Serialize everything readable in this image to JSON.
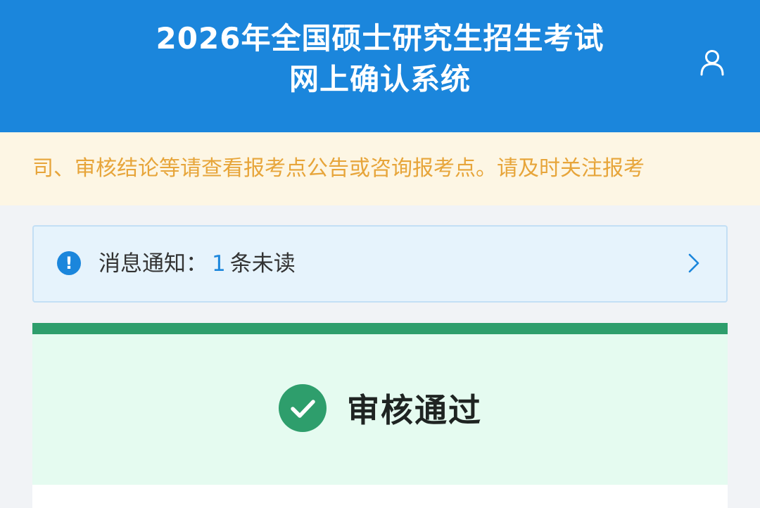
{
  "header": {
    "title_line1": "2026年全国硕士研究生招生考试",
    "title_line2": "网上确认系统",
    "user_icon": "user-icon",
    "bg_color": "#1b86dc"
  },
  "notice": {
    "text": "司、审核结论等请查看报考点公告或咨询报考点。请及时关注报考",
    "color": "#e7a53a"
  },
  "message": {
    "icon": "info-icon",
    "label": "消息通知：",
    "count": "1",
    "suffix": "条未读",
    "arrow_icon": "chevron-right-icon"
  },
  "status": {
    "icon": "check-circle-icon",
    "text": "审核通过",
    "color": "#2e9e6c"
  }
}
